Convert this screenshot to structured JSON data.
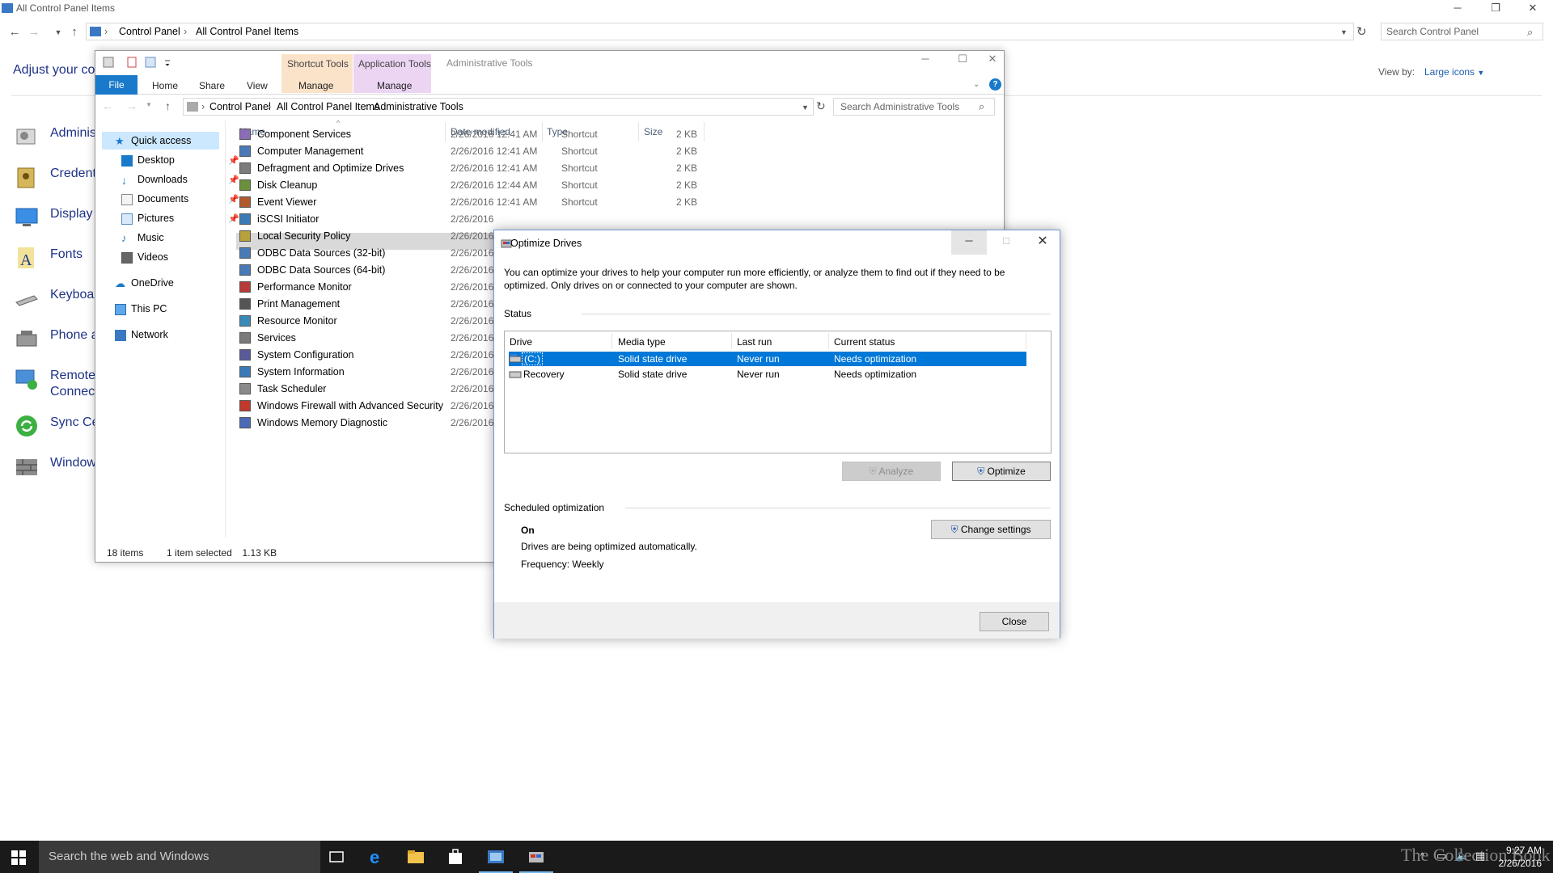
{
  "control_panel": {
    "title": "All Control Panel Items",
    "breadcrumb": [
      "Control Panel",
      "All Control Panel Items"
    ],
    "search_placeholder": "Search Control Panel",
    "heading": "Adjust your co",
    "view_by_label": "View by:",
    "view_by_value": "Large icons",
    "items": [
      "Adminis",
      "Credent",
      "Display",
      "Fonts",
      "Keyboar",
      "Phone a",
      "Remote",
      "Connect",
      "Sync Ce",
      "Window"
    ]
  },
  "explorer": {
    "title": "Administrative Tools",
    "context_tabs": {
      "shortcut_tools": "Shortcut Tools",
      "application_tools": "Application Tools"
    },
    "ribbon_tabs": {
      "file": "File",
      "home": "Home",
      "share": "Share",
      "view": "View",
      "manage1": "Manage",
      "manage2": "Manage"
    },
    "breadcrumb": [
      "Control Panel",
      "All Control Panel Items",
      "Administrative Tools"
    ],
    "search_placeholder": "Search Administrative Tools",
    "nav": {
      "quick_access": "Quick access",
      "desktop": "Desktop",
      "downloads": "Downloads",
      "documents": "Documents",
      "pictures": "Pictures",
      "music": "Music",
      "videos": "Videos",
      "onedrive": "OneDrive",
      "this_pc": "This PC",
      "network": "Network"
    },
    "columns": {
      "name": "Name",
      "date": "Date modified",
      "type": "Type",
      "size": "Size"
    },
    "files": [
      {
        "name": "Component Services",
        "date": "2/26/2016 12:41 AM",
        "type": "Shortcut",
        "size": "2 KB"
      },
      {
        "name": "Computer Management",
        "date": "2/26/2016 12:41 AM",
        "type": "Shortcut",
        "size": "2 KB"
      },
      {
        "name": "Defragment and Optimize Drives",
        "date": "2/26/2016 12:41 AM",
        "type": "Shortcut",
        "size": "2 KB"
      },
      {
        "name": "Disk Cleanup",
        "date": "2/26/2016 12:44 AM",
        "type": "Shortcut",
        "size": "2 KB"
      },
      {
        "name": "Event Viewer",
        "date": "2/26/2016 12:41 AM",
        "type": "Shortcut",
        "size": "2 KB"
      },
      {
        "name": "iSCSI Initiator",
        "date": "2/26/2016",
        "type": "",
        "size": ""
      },
      {
        "name": "Local Security Policy",
        "date": "2/26/2016",
        "type": "",
        "size": ""
      },
      {
        "name": "ODBC Data Sources (32-bit)",
        "date": "2/26/2016",
        "type": "",
        "size": ""
      },
      {
        "name": "ODBC Data Sources (64-bit)",
        "date": "2/26/2016",
        "type": "",
        "size": ""
      },
      {
        "name": "Performance Monitor",
        "date": "2/26/2016",
        "type": "",
        "size": ""
      },
      {
        "name": "Print Management",
        "date": "2/26/2016",
        "type": "",
        "size": ""
      },
      {
        "name": "Resource Monitor",
        "date": "2/26/2016",
        "type": "",
        "size": ""
      },
      {
        "name": "Services",
        "date": "2/26/2016",
        "type": "",
        "size": ""
      },
      {
        "name": "System Configuration",
        "date": "2/26/2016",
        "type": "",
        "size": ""
      },
      {
        "name": "System Information",
        "date": "2/26/2016",
        "type": "",
        "size": ""
      },
      {
        "name": "Task Scheduler",
        "date": "2/26/2016",
        "type": "",
        "size": ""
      },
      {
        "name": "Windows Firewall with Advanced Security",
        "date": "2/26/2016",
        "type": "",
        "size": ""
      },
      {
        "name": "Windows Memory Diagnostic",
        "date": "2/26/2016",
        "type": "",
        "size": ""
      }
    ],
    "status": {
      "items": "18 items",
      "selected": "1 item selected",
      "size": "1.13 KB"
    }
  },
  "dialog": {
    "title": "Optimize Drives",
    "description": "You can optimize your drives to help your computer run more efficiently, or analyze them to find out if they need to be optimized. Only drives on or connected to your computer are shown.",
    "status_label": "Status",
    "columns": {
      "drive": "Drive",
      "media": "Media type",
      "last_run": "Last run",
      "status": "Current status"
    },
    "drives": [
      {
        "drive": "(C:)",
        "media": "Solid state drive",
        "last_run": "Never run",
        "status": "Needs optimization"
      },
      {
        "drive": "Recovery",
        "media": "Solid state drive",
        "last_run": "Never run",
        "status": "Needs optimization"
      }
    ],
    "analyze_label": "Analyze",
    "optimize_label": "Optimize",
    "scheduled_label": "Scheduled optimization",
    "schedule_state": "On",
    "schedule_desc": "Drives are being optimized automatically.",
    "frequency": "Frequency: Weekly",
    "change_settings_label": "Change settings",
    "close_label": "Close"
  },
  "taskbar": {
    "search_placeholder": "Search the web and Windows",
    "time": "9:27 AM",
    "date": "2/26/2016",
    "watermark": "The Collection Book"
  },
  "colors": {
    "accent": "#0078d7",
    "link": "#1e3287",
    "taskbar": "#1a1a1a"
  }
}
